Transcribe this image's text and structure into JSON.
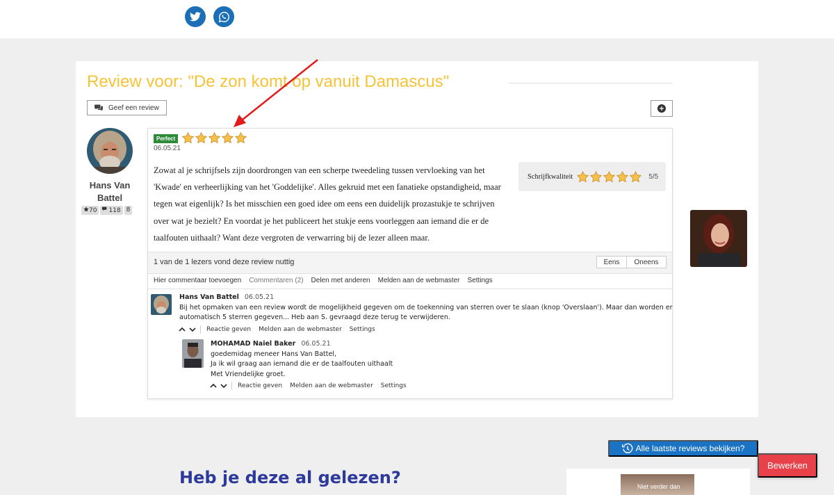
{
  "social": {
    "twitter_icon": "twitter-icon",
    "whatsapp_icon": "whatsapp-icon"
  },
  "review": {
    "title": "Review voor: \"De zon komt op vanuit Damascus\"",
    "give_review_label": "Geef een review",
    "reviewer": {
      "name": "Hans Van Battel",
      "stars_count": "70",
      "comments_count": "118",
      "level": "8"
    },
    "badge": "Perfect",
    "rating_stars": 5,
    "date": "06.05.21",
    "text": "Zowat al je schrijfsels zijn doordrongen van een scherpe tweedeling tussen vervloeking van het 'Kwade' en verheerlijking van het 'Goddelijke'. Alles gekruid met een fanatieke opstandigheid, maar tegen wat eigenlijk? Is het misschien een goed idee om eens een duidelijk prozastukje te schrijven over wat je bezielt? En voordat je het publiceert het stukje eens voorleggen aan iemand die er de taalfouten uithaalt? Want deze vergroten de verwarring bij de lezer alleen maar.",
    "quality": {
      "label": "Schrijfkwaliteit",
      "stars": 5,
      "score": "5/5"
    },
    "useful_text": "1 van de 1 lezers vond deze review nuttig",
    "agree_label": "Eens",
    "disagree_label": "Oneens",
    "actions": {
      "add_comment": "Hier commentaar toevoegen",
      "comments": "Commentaren (2)",
      "share": "Delen met anderen",
      "report": "Melden aan de webmaster",
      "settings": "Settings"
    }
  },
  "comments": [
    {
      "author": "Hans Van Battel",
      "date": "06.05.21",
      "lines": [
        "Bij het opmaken van een review wordt de mogelijkheid gegeven om de toekenning van sterren over te slaan (knop 'Overslaan'). Maar dan worden er",
        "automatisch 5 sterren gegeven... Heb aan S. gevraagd deze terug te verwijderen."
      ],
      "reply_label": "Reactie geven",
      "report_label": "Melden aan de webmaster",
      "settings_label": "Settings"
    },
    {
      "author": "MOHAMAD Naiel Baker",
      "date": "06.05.21",
      "lines": [
        "goedemidag meneer Hans Van Battel,",
        "Ja ik wil graag aan iemand die er de taalfouten uithaalt",
        "Met Vriendelijke groet."
      ],
      "reply_label": "Reactie geven",
      "report_label": "Melden aan de webmaster",
      "settings_label": "Settings"
    }
  ],
  "latest_reviews_label": "Alle laatste reviews bekijken?",
  "edit_label": "Bewerken",
  "read_heading": "Heb je deze al gelezen?",
  "book_thumb_text": "Niet verder dan",
  "colors": {
    "title": "#f6c338",
    "accent_blue": "#1a73c4",
    "edit_red": "#e8414a",
    "badge_green": "#2e8b3a",
    "heading_blue": "#2d3a9b"
  }
}
